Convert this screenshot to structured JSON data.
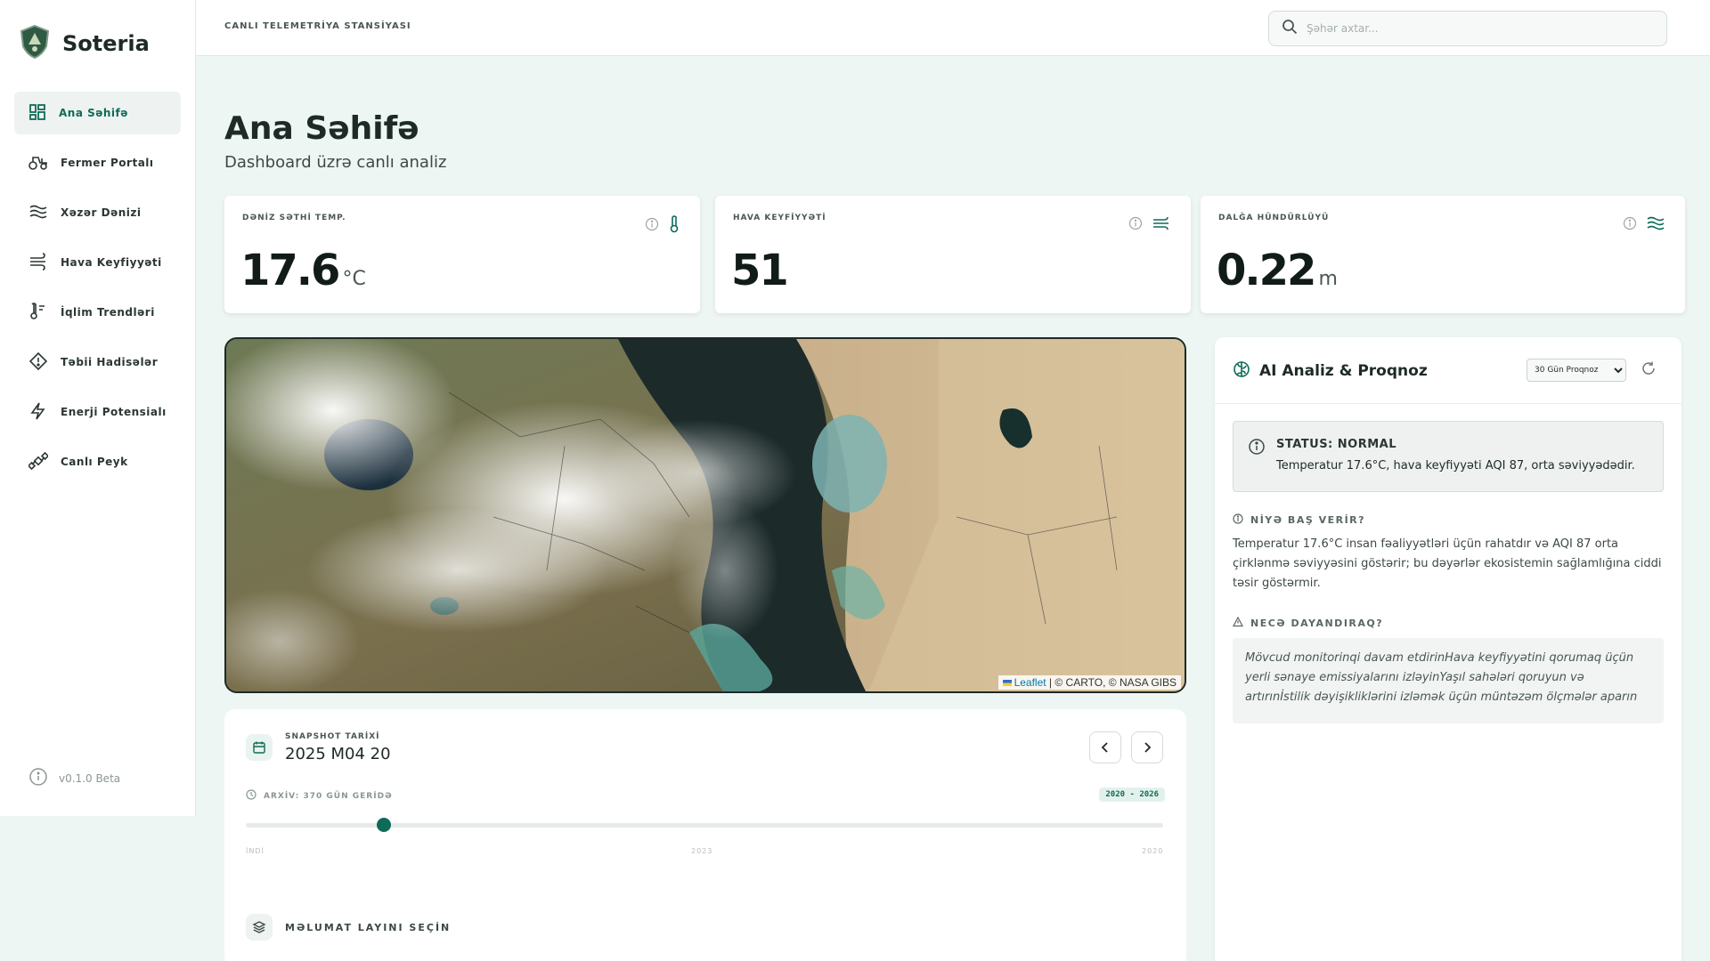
{
  "app": {
    "name": "Soteria",
    "version": "v0.1.0 Beta"
  },
  "sidebar": {
    "items": [
      {
        "label": "Ana Səhifə",
        "icon": "dashboard-icon",
        "active": true
      },
      {
        "label": "Fermer Portalı",
        "icon": "tractor-icon"
      },
      {
        "label": "Xəzər Dənizi",
        "icon": "waves-icon"
      },
      {
        "label": "Hava Keyfiyyəti",
        "icon": "wind-icon"
      },
      {
        "label": "İqlim Trendləri",
        "icon": "thermometer-icon"
      },
      {
        "label": "Təbii Hadisələr",
        "icon": "warning-diamond-icon"
      },
      {
        "label": "Enerji Potensialı",
        "icon": "lightning-icon"
      },
      {
        "label": "Canlı Peyk",
        "icon": "satellite-icon"
      }
    ]
  },
  "topbar": {
    "label": "CANLI TELEMETRİYA STANSİYASI",
    "search_placeholder": "Şəhər axtar..."
  },
  "page": {
    "title": "Ana Səhifə",
    "subtitle": "Dashboard üzrə canlı analiz"
  },
  "cards": [
    {
      "label": "DƏNİZ SƏTHİ TEMP.",
      "value": "17.6",
      "unit": "°C",
      "icon": "thermometer-icon"
    },
    {
      "label": "HAVA KEYFİYYƏTİ",
      "value": "51",
      "unit": "",
      "icon": "wind-icon"
    },
    {
      "label": "DALĞA HÜNDÜRLÜYÜ",
      "value": "0.22",
      "unit": "m",
      "icon": "waves-icon"
    }
  ],
  "map": {
    "attribution_link": "Leaflet",
    "attribution_rest": " | © CARTO, © NASA GIBS"
  },
  "snapshot": {
    "label": "SNAPSHOT TARİXİ",
    "date": "2025 M04 20",
    "archive": "ARXİV: 370 GÜN GERİDƏ",
    "range": "2020 - 2026",
    "position": 0.15,
    "ticks": [
      "İNDİ",
      "2023",
      "2020"
    ],
    "layer_label": "MƏLUMAT LAYINI SEÇİN"
  },
  "ai": {
    "title": "AI Analiz & Proqnoz",
    "forecast_option": "30 Gün Proqnoz",
    "status_title": "STATUS: NORMAL",
    "status_text": "Temperatur 17.6°C, hava keyfiyyəti AQI 87, orta səviyyədədir.",
    "why_title": "NİYƏ BAŞ VERİR?",
    "why_text": "Temperatur 17.6°C insan fəaliyyətləri üçün rahatdır və AQI 87 orta çirklənmə səviyyəsini göstərir; bu dəyərlər ekosistemin sağlamlığına ciddi təsir göstərmir.",
    "how_title": "NECƏ DAYANDIRAQ?",
    "how_text": "Mövcud monitorinqi davam etdirinHava keyfiyyətini qorumaq üçün yerli sənaye emissiyalarını izləyinYaşıl sahələri qoruyun və artırınİstilik dəyişikliklərini izləmək üçün müntəzəm ölçmələr aparın"
  },
  "colors": {
    "accent": "#0f6b58",
    "background": "#eef6f3"
  }
}
